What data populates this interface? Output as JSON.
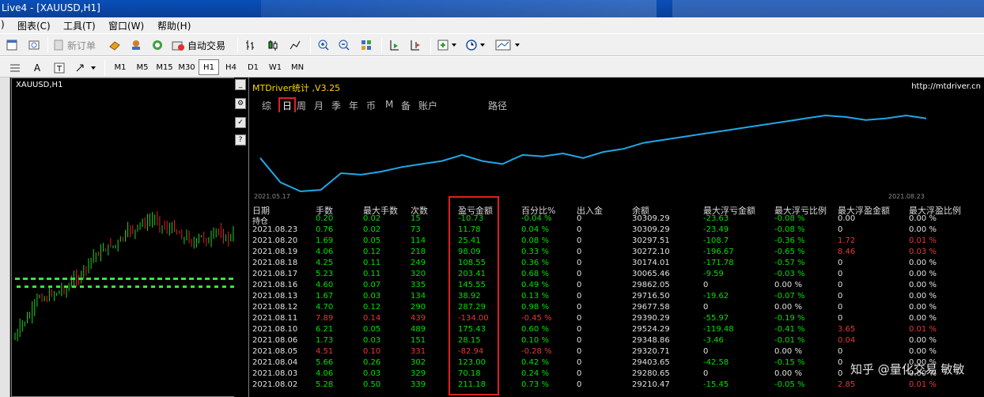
{
  "window": {
    "title": "Live4 - [XAUUSD,H1]"
  },
  "menu": [
    "图表(C)",
    "工具(T)",
    "窗口(W)",
    "帮助(H)"
  ],
  "menu_prefix": ")",
  "toolbar": {
    "new_order": "新订单",
    "auto_trade": "自动交易"
  },
  "timeframes": [
    "M1",
    "M5",
    "M15",
    "M30",
    "H1",
    "H4",
    "D1",
    "W1",
    "MN"
  ],
  "active_timeframe": "H1",
  "chart": {
    "symbol_label": "XAUUSD,H1"
  },
  "indicator": {
    "title": "MTDriver统计 ,V3.25",
    "url": "http://mtdriver.cn",
    "tabs": [
      "综",
      "日",
      "周",
      "月",
      "季",
      "年",
      "币",
      "M",
      "备",
      "账户",
      "路径"
    ],
    "active_tab": "日",
    "equity_start_date": "2021.05.17",
    "equity_end_date": "2021.08.23",
    "equity_color": "#1fa8e8",
    "equity_curve": [
      29000,
      28200,
      27900,
      27950,
      28500,
      28450,
      28550,
      28700,
      28800,
      28900,
      29100,
      28900,
      28800,
      29100,
      29050,
      29150,
      29000,
      29200,
      29300,
      29500,
      29600,
      29700,
      29800,
      29900,
      30000,
      30100,
      30200,
      30300,
      30400,
      30350,
      30250,
      30300,
      30400,
      30300
    ],
    "columns": [
      "日期",
      "手数",
      "最大手数",
      "次数",
      "盈亏金额",
      "百分比%",
      "出入金",
      "余额",
      "最大浮亏金额",
      "最大浮亏比例",
      "最大浮盈金额",
      "最大浮盈比例"
    ],
    "holding_row": {
      "date": "持仓",
      "lots": "0.20",
      "max_lots": "0.02",
      "count": "15",
      "pnl": "-10.73",
      "pct": "-0.04 %",
      "inout": "0",
      "balance": "30309.29",
      "max_float_loss": "-23.63",
      "max_float_loss_pct": "-0.08 %",
      "max_float_profit": "0.00",
      "max_float_profit_pct": "0.00 %"
    },
    "rows": [
      {
        "date": "2021.08.23",
        "lots": "0.76",
        "max_lots": "0.02",
        "count": "73",
        "pnl": "11.78",
        "pct": "0.04 %",
        "inout": "0",
        "balance": "30309.29",
        "max_float_loss": "-23.49",
        "max_float_loss_pct": "-0.08 %",
        "max_float_profit": "0",
        "max_float_profit_pct": "0.00 %",
        "sign": "pos"
      },
      {
        "date": "2021.08.20",
        "lots": "1.69",
        "max_lots": "0.05",
        "count": "114",
        "pnl": "25.41",
        "pct": "0.08 %",
        "inout": "0",
        "balance": "30297.51",
        "max_float_loss": "-108.7",
        "max_float_loss_pct": "-0.36 %",
        "max_float_profit": "1.72",
        "max_float_profit_pct": "0.01 %",
        "sign": "pos"
      },
      {
        "date": "2021.08.19",
        "lots": "4.06",
        "max_lots": "0.12",
        "count": "218",
        "pnl": "98.09",
        "pct": "0.33 %",
        "inout": "0",
        "balance": "30272.10",
        "max_float_loss": "-196.67",
        "max_float_loss_pct": "-0.65 %",
        "max_float_profit": "8.46",
        "max_float_profit_pct": "0.03 %",
        "sign": "pos"
      },
      {
        "date": "2021.08.18",
        "lots": "4.25",
        "max_lots": "0.11",
        "count": "249",
        "pnl": "108.55",
        "pct": "0.36 %",
        "inout": "0",
        "balance": "30174.01",
        "max_float_loss": "-171.78",
        "max_float_loss_pct": "-0.57 %",
        "max_float_profit": "0",
        "max_float_profit_pct": "0.00 %",
        "sign": "pos"
      },
      {
        "date": "2021.08.17",
        "lots": "5.23",
        "max_lots": "0.11",
        "count": "320",
        "pnl": "203.41",
        "pct": "0.68 %",
        "inout": "0",
        "balance": "30065.46",
        "max_float_loss": "-9.59",
        "max_float_loss_pct": "-0.03 %",
        "max_float_profit": "0",
        "max_float_profit_pct": "0.00 %",
        "sign": "pos"
      },
      {
        "date": "2021.08.16",
        "lots": "4.60",
        "max_lots": "0.07",
        "count": "335",
        "pnl": "145.55",
        "pct": "0.49 %",
        "inout": "0",
        "balance": "29862.05",
        "max_float_loss": "0",
        "max_float_loss_pct": "0.00 %",
        "max_float_profit": "0",
        "max_float_profit_pct": "0.00 %",
        "sign": "pos"
      },
      {
        "date": "2021.08.13",
        "lots": "1.67",
        "max_lots": "0.03",
        "count": "134",
        "pnl": "38.92",
        "pct": "0.13 %",
        "inout": "0",
        "balance": "29716.50",
        "max_float_loss": "-19.62",
        "max_float_loss_pct": "-0.07 %",
        "max_float_profit": "0",
        "max_float_profit_pct": "0.00 %",
        "sign": "pos"
      },
      {
        "date": "2021.08.12",
        "lots": "4.70",
        "max_lots": "0.12",
        "count": "290",
        "pnl": "287.29",
        "pct": "0.98 %",
        "inout": "0",
        "balance": "29677.58",
        "max_float_loss": "0",
        "max_float_loss_pct": "0.00 %",
        "max_float_profit": "0",
        "max_float_profit_pct": "0.00 %",
        "sign": "pos"
      },
      {
        "date": "2021.08.11",
        "lots": "7.89",
        "max_lots": "0.14",
        "count": "439",
        "pnl": "-134.00",
        "pct": "-0.45 %",
        "inout": "0",
        "balance": "29390.29",
        "max_float_loss": "-55.97",
        "max_float_loss_pct": "-0.19 %",
        "max_float_profit": "0",
        "max_float_profit_pct": "0.00 %",
        "sign": "neg"
      },
      {
        "date": "2021.08.10",
        "lots": "6.21",
        "max_lots": "0.05",
        "count": "489",
        "pnl": "175.43",
        "pct": "0.60 %",
        "inout": "0",
        "balance": "29524.29",
        "max_float_loss": "-119.48",
        "max_float_loss_pct": "-0.41 %",
        "max_float_profit": "3.65",
        "max_float_profit_pct": "0.01 %",
        "sign": "pos"
      },
      {
        "date": "2021.08.06",
        "lots": "1.73",
        "max_lots": "0.03",
        "count": "151",
        "pnl": "28.15",
        "pct": "0.10 %",
        "inout": "0",
        "balance": "29348.86",
        "max_float_loss": "-3.46",
        "max_float_loss_pct": "-0.01 %",
        "max_float_profit": "0.04",
        "max_float_profit_pct": "0.00 %",
        "sign": "pos"
      },
      {
        "date": "2021.08.05",
        "lots": "4.51",
        "max_lots": "0.10",
        "count": "331",
        "pnl": "-82.94",
        "pct": "-0.28 %",
        "inout": "0",
        "balance": "29320.71",
        "max_float_loss": "0",
        "max_float_loss_pct": "0.00 %",
        "max_float_profit": "0",
        "max_float_profit_pct": "0.00 %",
        "sign": "neg"
      },
      {
        "date": "2021.08.04",
        "lots": "5.66",
        "max_lots": "0.26",
        "count": "302",
        "pnl": "123.00",
        "pct": "0.42 %",
        "inout": "0",
        "balance": "29403.65",
        "max_float_loss": "-42.58",
        "max_float_loss_pct": "-0.15 %",
        "max_float_profit": "0",
        "max_float_profit_pct": "0.00 %",
        "sign": "pos"
      },
      {
        "date": "2021.08.03",
        "lots": "4.06",
        "max_lots": "0.03",
        "count": "329",
        "pnl": "70.18",
        "pct": "0.24 %",
        "inout": "0",
        "balance": "29280.65",
        "max_float_loss": "0",
        "max_float_loss_pct": "0.00 %",
        "max_float_profit": "0",
        "max_float_profit_pct": "0.00 %",
        "sign": "pos"
      },
      {
        "date": "2021.08.02",
        "lots": "5.28",
        "max_lots": "0.50",
        "count": "339",
        "pnl": "211.18",
        "pct": "0.73 %",
        "inout": "0",
        "balance": "29210.47",
        "max_float_loss": "-15.45",
        "max_float_loss_pct": "-0.05 %",
        "max_float_profit": "2.85",
        "max_float_profit_pct": "0.01 %",
        "sign": "pos"
      }
    ]
  },
  "watermark": "知乎 @量化交易 敏敏"
}
